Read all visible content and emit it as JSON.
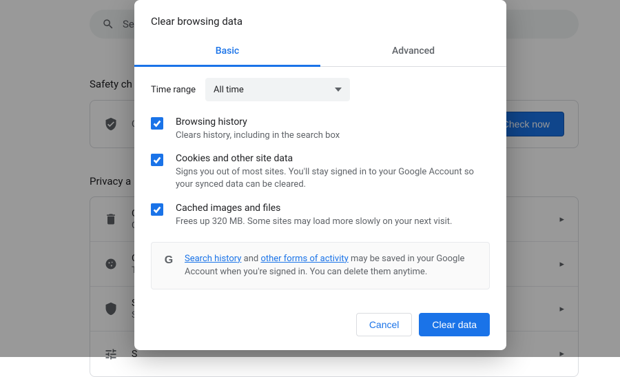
{
  "background": {
    "search_placeholder": "Se",
    "safety_label": "Safety ch",
    "safety_text": "C",
    "check_now": "Check now",
    "privacy_label": "Privacy a",
    "rows": [
      {
        "t1": "C",
        "t2": "C"
      },
      {
        "t1": "C",
        "t2": "T"
      },
      {
        "t1": "S",
        "t2": "S"
      },
      {
        "t1": "S",
        "t2": ""
      }
    ]
  },
  "dialog": {
    "title": "Clear browsing data",
    "tabs": {
      "basic": "Basic",
      "advanced": "Advanced"
    },
    "time_label": "Time range",
    "time_value": "All time",
    "items": [
      {
        "title": "Browsing history",
        "desc": "Clears history, including in the search box"
      },
      {
        "title": "Cookies and other site data",
        "desc": "Signs you out of most sites. You'll stay signed in to your Google Account so your synced data can be cleared."
      },
      {
        "title": "Cached images and files",
        "desc": "Frees up 320 MB. Some sites may load more slowly on your next visit."
      }
    ],
    "info": {
      "link1": "Search history",
      "mid": " and ",
      "link2": "other forms of activity",
      "tail": " may be saved in your Google Account when you're signed in. You can delete them anytime."
    },
    "actions": {
      "cancel": "Cancel",
      "confirm": "Clear data"
    }
  }
}
